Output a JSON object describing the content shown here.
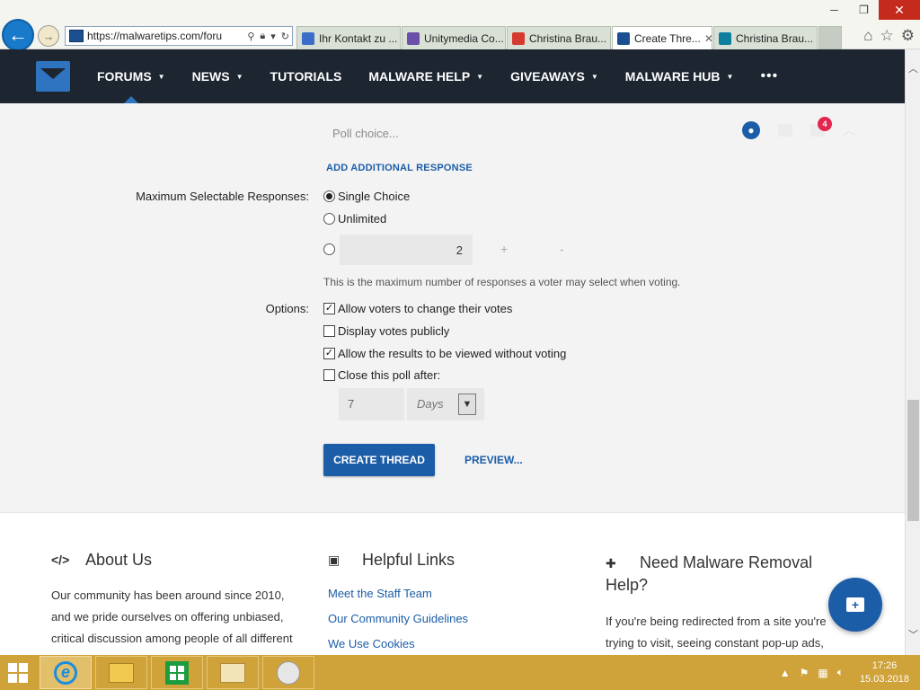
{
  "browser": {
    "address_url": "https://malwaretips.com/foru",
    "tabs": [
      {
        "label": "Ihr Kontakt zu ...",
        "icon_color": "#3a6ec8",
        "active": false
      },
      {
        "label": "Unitymedia Co...",
        "icon_color": "#6b4fa8",
        "active": false
      },
      {
        "label": "Christina Brau...",
        "icon_color": "#d63a2f",
        "active": false
      },
      {
        "label": "Create Thre...",
        "icon_color": "#1c4f91",
        "active": true
      },
      {
        "label": "Christina Brau...",
        "icon_color": "#0f7fa0",
        "active": false
      }
    ],
    "tab_close": "✕"
  },
  "nav": {
    "items": [
      {
        "label": "FORUMS",
        "has_caret": true,
        "active": true
      },
      {
        "label": "NEWS",
        "has_caret": true
      },
      {
        "label": "TUTORIALS",
        "has_caret": false
      },
      {
        "label": "MALWARE HELP",
        "has_caret": true
      },
      {
        "label": "GIVEAWAYS",
        "has_caret": true
      },
      {
        "label": "MALWARE HUB",
        "has_caret": true
      }
    ],
    "more": "•••"
  },
  "form": {
    "poll_choice_placeholder": "Poll choice...",
    "user_badge_count": "4",
    "add_response": "ADD ADDITIONAL RESPONSE",
    "max_label": "Maximum Selectable Responses:",
    "single_choice": "Single Choice",
    "unlimited": "Unlimited",
    "max_number": "2",
    "plus": "+",
    "minus": "-",
    "hint": "This is the maximum number of responses a voter may select when voting.",
    "options_label": "Options:",
    "options": [
      {
        "label": "Allow voters to change their votes",
        "checked": true
      },
      {
        "label": "Display votes publicly",
        "checked": false
      },
      {
        "label": "Allow the results to be viewed without voting",
        "checked": true
      },
      {
        "label": "Close this poll after:",
        "checked": false
      }
    ],
    "close_after_value": "7",
    "close_after_unit": "Days",
    "create_button": "CREATE THREAD",
    "preview_button": "PREVIEW..."
  },
  "footer": {
    "about": {
      "title": "About Us",
      "text_lines": [
        "Our community has been around since 2010,",
        "and we pride ourselves on offering unbiased,",
        "critical discussion among people of all different"
      ]
    },
    "links": {
      "title": "Helpful Links",
      "items": [
        "Meet the Staff Team",
        "Our Community Guidelines",
        "We Use Cookies"
      ]
    },
    "removal": {
      "title_line1": "Need Malware Removal",
      "title_line2": "Help?",
      "text_lines": [
        "If you're being redirected from a site you're",
        "trying to visit, seeing constant pop-up ads,"
      ]
    }
  },
  "taskbar": {
    "time": "17:26",
    "date": "15.03.2018"
  },
  "colors": {
    "accent": "#1c5da8",
    "nav_bg": "#1c2530",
    "taskbar": "#cfa23a",
    "badge": "#e2264d"
  }
}
